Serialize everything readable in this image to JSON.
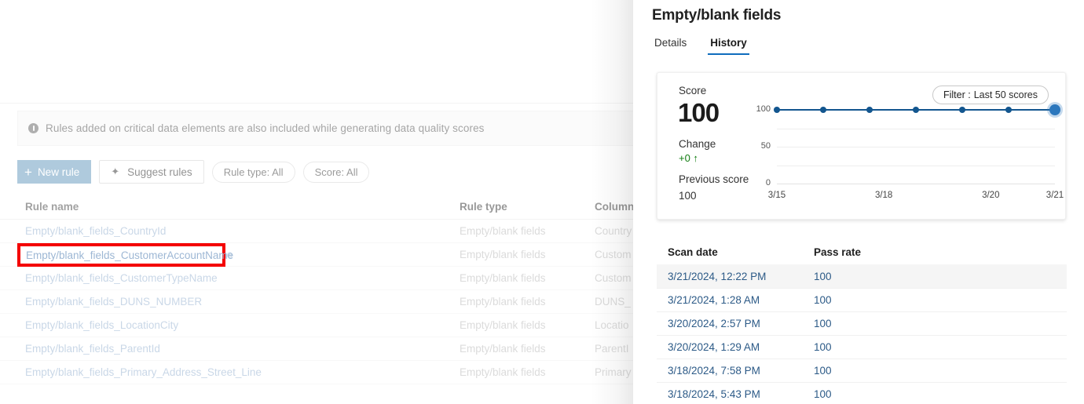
{
  "background_page": {
    "info_banner": {
      "icon": "info-circle-icon",
      "text": "Rules added on critical data elements are also included while generating data quality scores"
    },
    "toolbar": {
      "new_rule_label": "New rule",
      "new_rule_icon": "plus-icon",
      "suggest_rules_label": "Suggest rules",
      "suggest_rules_icon": "sparkle-icon",
      "rule_type_filter_label": "Rule type: All",
      "score_filter_label": "Score: All"
    },
    "rules_table": {
      "columns": [
        "Rule name",
        "Rule type",
        "Column"
      ],
      "rows": [
        {
          "name": "Empty/blank_fields_CountryId",
          "type": "Empty/blank fields",
          "column": "Country"
        },
        {
          "name": "Empty/blank_fields_CustomerAccountName",
          "type": "Empty/blank fields",
          "column": "Custom"
        },
        {
          "name": "Empty/blank_fields_CustomerTypeName",
          "type": "Empty/blank fields",
          "column": "Custom"
        },
        {
          "name": "Empty/blank_fields_DUNS_NUMBER",
          "type": "Empty/blank fields",
          "column": "DUNS_"
        },
        {
          "name": "Empty/blank_fields_LocationCity",
          "type": "Empty/blank fields",
          "column": "Locatio"
        },
        {
          "name": "Empty/blank_fields_ParentId",
          "type": "Empty/blank fields",
          "column": "ParentI"
        },
        {
          "name": "Empty/blank_fields_Primary_Address_Street_Line",
          "type": "Empty/blank fields",
          "column": "Primary"
        }
      ]
    },
    "annotation": {
      "highlight_color": "#f40000",
      "highlighted_text": "Empty/blank_fields_CustomerAccountName"
    }
  },
  "panel": {
    "title": "Empty/blank fields",
    "tabs": [
      {
        "label": "Details",
        "active": false
      },
      {
        "label": "History",
        "active": true
      }
    ],
    "accent_color": "#0f6cbd",
    "score_card": {
      "score_label": "Score",
      "score_value": "100",
      "change_label": "Change",
      "change_value": "+0 ↑",
      "change_color": "#107c10",
      "previous_score_label": "Previous score",
      "previous_score_value": "100",
      "filter": {
        "key": "Filter :",
        "value": "Last 50 scores"
      }
    },
    "scan_table": {
      "columns": [
        "Scan date",
        "Pass rate"
      ],
      "rows": [
        {
          "date": "3/21/2024, 12:22 PM",
          "rate": "100",
          "selected": true
        },
        {
          "date": "3/21/2024, 1:28 AM",
          "rate": "100",
          "selected": false
        },
        {
          "date": "3/20/2024, 2:57 PM",
          "rate": "100",
          "selected": false
        },
        {
          "date": "3/20/2024, 1:29 AM",
          "rate": "100",
          "selected": false
        },
        {
          "date": "3/18/2024, 7:58 PM",
          "rate": "100",
          "selected": false
        },
        {
          "date": "3/18/2024, 5:43 PM",
          "rate": "100",
          "selected": false
        }
      ]
    }
  },
  "chart_data": {
    "type": "line",
    "title": "Score",
    "xlabel": "",
    "ylabel": "",
    "ylim": [
      0,
      100
    ],
    "yticks": [
      0,
      50,
      100
    ],
    "xticks": [
      "3/15",
      "3/18",
      "3/20",
      "3/21"
    ],
    "xtick_positions": [
      0,
      0.3846,
      0.7692,
      1.0
    ],
    "x": [
      "3/15",
      "3/16",
      "3/18",
      "3/19",
      "3/20",
      "3/20",
      "3/21"
    ],
    "values": [
      100,
      100,
      100,
      100,
      100,
      100,
      100
    ],
    "series": [
      {
        "name": "Score",
        "values": [
          100,
          100,
          100,
          100,
          100,
          100,
          100
        ],
        "color": "#13568f"
      }
    ],
    "grid": true,
    "legend": "none",
    "highlight_last_point": true
  }
}
